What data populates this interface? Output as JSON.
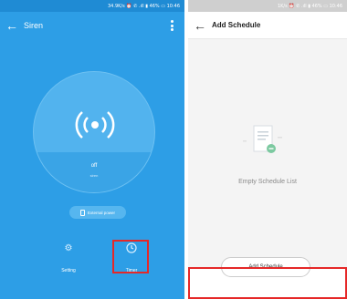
{
  "left_screen": {
    "status_text": "34.9K/s ⏰ ✆ .ıll ▮ 46% ▭ 10:46",
    "title": "Siren",
    "back_icon": "arrow-left-icon",
    "more_icon": "more-vertical-icon",
    "siren_icon": "siren-wave-icon",
    "state": "off",
    "state_sub": "siren",
    "power_label": "External power",
    "tabs": [
      {
        "label": "Setting",
        "icon": "gear-icon"
      },
      {
        "label": "Timer",
        "icon": "clock-icon"
      }
    ],
    "accent": "#2d9ee6",
    "highlight_color": "#e52828"
  },
  "right_screen": {
    "status_text": "1K/s ⏰ ✆ .ıll ▮ 46% ▭ 10:46",
    "title": "Add Schedule",
    "back_icon": "arrow-left-icon",
    "empty_icon": "document-icon",
    "empty_text": "Empty Schedule List",
    "add_button_label": "Add Schedule",
    "highlight_color": "#e52828"
  }
}
